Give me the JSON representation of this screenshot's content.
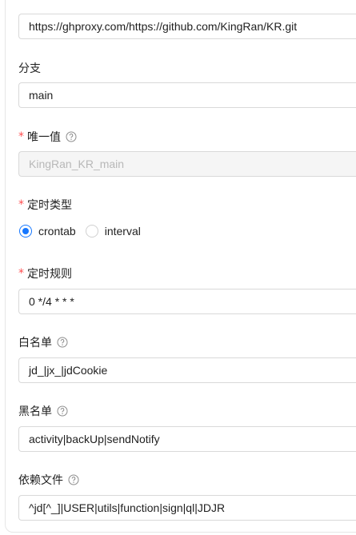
{
  "repo_url": {
    "value": "https://ghproxy.com/https://github.com/KingRan/KR.git"
  },
  "branch": {
    "label": "分支",
    "value": "main"
  },
  "unique_value": {
    "required_mark": "*",
    "label": "唯一值",
    "value": "KingRan_KR_main",
    "help_icon": "question-circle-icon"
  },
  "schedule_type": {
    "required_mark": "*",
    "label": "定时类型",
    "options": [
      {
        "label": "crontab",
        "checked": true
      },
      {
        "label": "interval",
        "checked": false
      }
    ],
    "accent": "#1677ff"
  },
  "schedule_rule": {
    "required_mark": "*",
    "label": "定时规则",
    "value": "0 */4 * * *"
  },
  "whitelist": {
    "label": "白名单",
    "value": "jd_|jx_|jdCookie",
    "help_icon": "question-circle-icon"
  },
  "blacklist": {
    "label": "黑名单",
    "value": "activity|backUp|sendNotify",
    "help_icon": "question-circle-icon"
  },
  "dependency_files": {
    "label": "依赖文件",
    "value": "^jd[^_]|USER|utils|function|sign|ql|JDJR",
    "help_icon": "question-circle-icon"
  },
  "colors": {
    "required": "#ff4d4f",
    "border": "#d9d9d9",
    "disabled_bg": "#f5f5f5"
  }
}
